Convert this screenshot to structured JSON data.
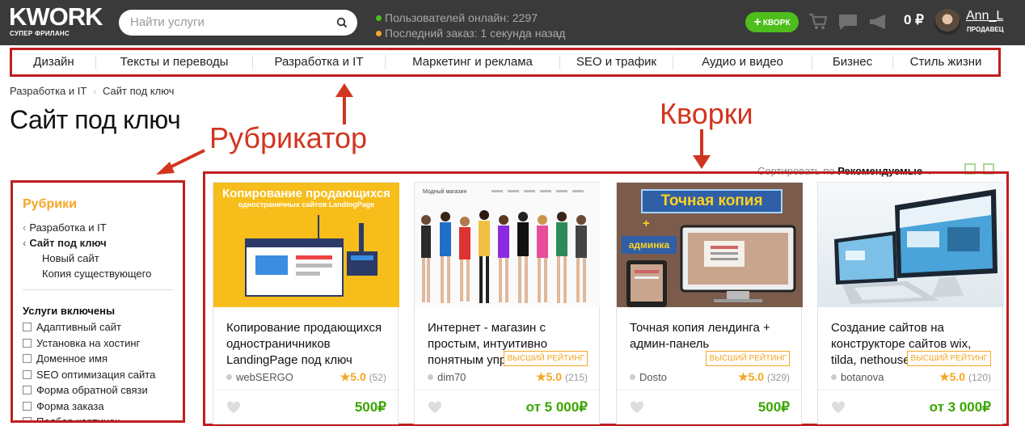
{
  "header": {
    "logo": "KWORK",
    "logo_sub": "СУПЕР ФРИЛАНС",
    "search_placeholder": "Найти услуги",
    "online": "Пользователей онлайн: 2297",
    "last_order": "Последний заказ: 1 секунда назад",
    "kwork_button": "КВОРК",
    "balance": "0 ₽",
    "username": "Ann_L",
    "role": "ПРОДАВЕЦ",
    "colors": {
      "bg": "#3a3a3a",
      "accent": "#4dbe1c",
      "logo": "#ffc107"
    }
  },
  "nav": [
    "Дизайн",
    "Тексты и переводы",
    "Разработка и IT",
    "Маркетинг и реклама",
    "SEO и трафик",
    "Аудио и видео",
    "Бизнес",
    "Стиль жизни"
  ],
  "breadcrumb": [
    "Разработка и IT",
    "Сайт под ключ"
  ],
  "page_title": "Сайт под ключ",
  "annotations": {
    "rubricator": "Рубрикатор",
    "kworks": "Кворки"
  },
  "sort": {
    "label": "Сортировать по",
    "value": "Рекомендуемые"
  },
  "sidebar": {
    "title": "Рубрики",
    "links": [
      {
        "label": "Разработка и IT",
        "back": true
      },
      {
        "label": "Сайт под ключ",
        "back": true,
        "current": true
      },
      {
        "label": "Новый сайт"
      },
      {
        "label": "Копия существующего"
      }
    ],
    "group_title": "Услуги включены",
    "checkboxes": [
      "Адаптивный сайт",
      "Установка на хостинг",
      "Доменное имя",
      "SEO оптимизация сайта",
      "Форма обратной связи",
      "Форма заказа",
      "Подбор картинок"
    ]
  },
  "cards": [
    {
      "thumb_title": "Копирование продающихся",
      "thumb_sub": "одностраничных сайтов LandingPage",
      "title": "Копирование продающихся одностраничников LandingPage под ключ",
      "author": "webSERGO",
      "rating": "5.0",
      "reviews": "(52)",
      "price": "500₽",
      "badge": ""
    },
    {
      "thumb_title": "Модный магазин",
      "title": "Интернет - магазин с простым, интуитивно понятным управлением",
      "author": "dim70",
      "rating": "5.0",
      "reviews": "(215)",
      "price": "от 5 000₽",
      "badge": "ВЫСШИЙ РЕЙТИНГ"
    },
    {
      "thumb_title": "Точная копия",
      "thumb_plus": "+",
      "thumb_sub": "админка",
      "title": "Точная копия лендинга + админ-панель",
      "author": "Dosto",
      "rating": "5.0",
      "reviews": "(329)",
      "price": "500₽",
      "badge": "ВЫСШИЙ РЕЙТИНГ"
    },
    {
      "title": "Создание сайтов на конструкторе сайтов wix, tilda, nethouse",
      "author": "botanova",
      "rating": "5.0",
      "reviews": "(120)",
      "price": "от 3 000₽",
      "badge": "ВЫСШИЙ РЕЙТИНГ"
    }
  ]
}
